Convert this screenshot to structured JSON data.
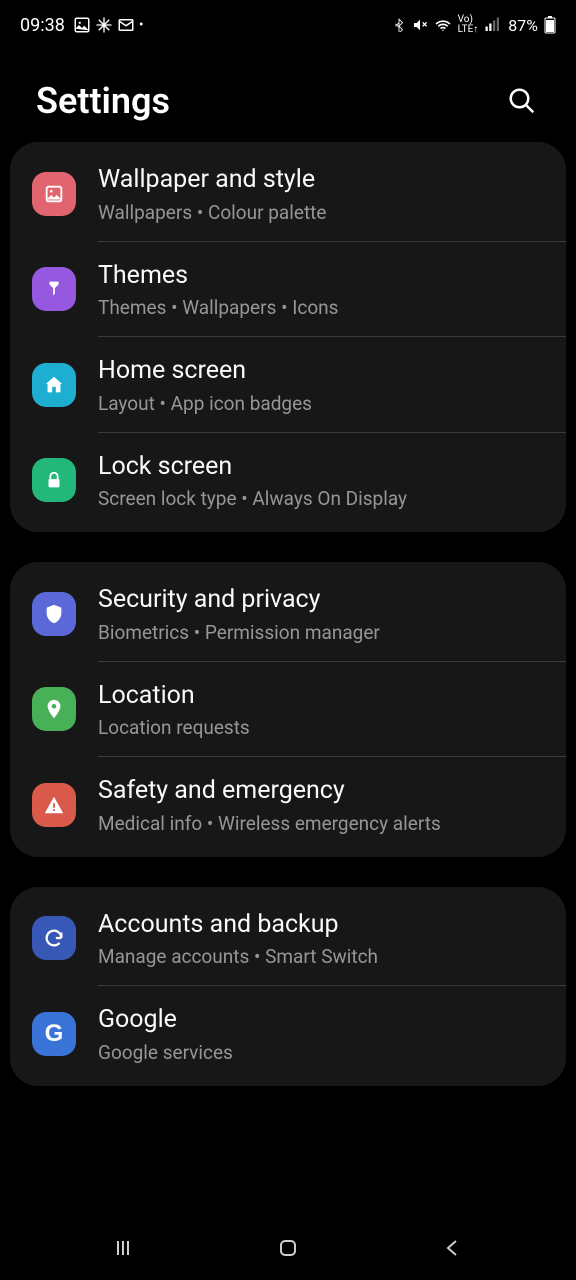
{
  "status": {
    "time": "09:38",
    "battery": "87%"
  },
  "header": {
    "title": "Settings"
  },
  "groups": [
    {
      "items": [
        {
          "title": "Wallpaper and style",
          "sub": "Wallpapers • Colour palette"
        },
        {
          "title": "Themes",
          "sub": "Themes • Wallpapers • Icons"
        },
        {
          "title": "Home screen",
          "sub": "Layout • App icon badges"
        },
        {
          "title": "Lock screen",
          "sub": "Screen lock type • Always On Display"
        }
      ]
    },
    {
      "items": [
        {
          "title": "Security and privacy",
          "sub": "Biometrics • Permission manager"
        },
        {
          "title": "Location",
          "sub": "Location requests"
        },
        {
          "title": "Safety and emergency",
          "sub": "Medical info • Wireless emergency alerts"
        }
      ]
    },
    {
      "items": [
        {
          "title": "Accounts and backup",
          "sub": "Manage accounts • Smart Switch"
        },
        {
          "title": "Google",
          "sub": "Google services"
        }
      ]
    }
  ]
}
